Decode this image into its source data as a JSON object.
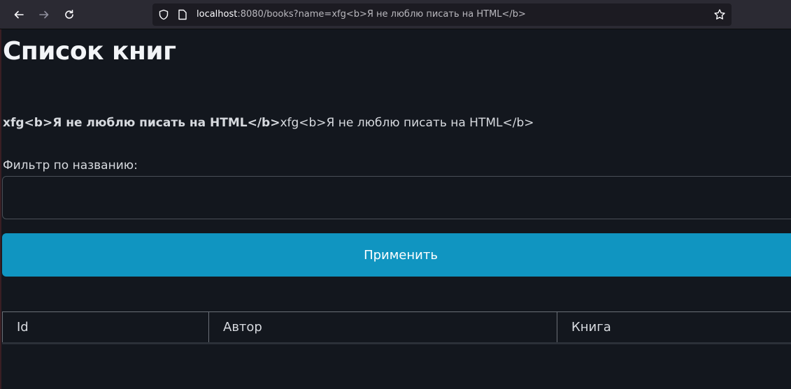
{
  "browser": {
    "url_host": "localhost",
    "url_rest": ":8080/books?name=xfg<b>Я не люблю писать на HTML</b>"
  },
  "page": {
    "title": "Список книг",
    "echo_bold": "xfg<b>Я не люблю писать на HTML</b>",
    "echo_plain": "xfg<b>Я не люблю писать на HTML</b>",
    "filter_label": "Фильтр по названию:",
    "filter_value": "",
    "apply_label": "Применить",
    "table": {
      "columns": [
        "Id",
        "Автор",
        "Книга"
      ],
      "rows": []
    }
  },
  "colors": {
    "page_bg": "#13171e",
    "toolbar_bg": "#2b2a33",
    "button_bg": "#1095c1"
  }
}
